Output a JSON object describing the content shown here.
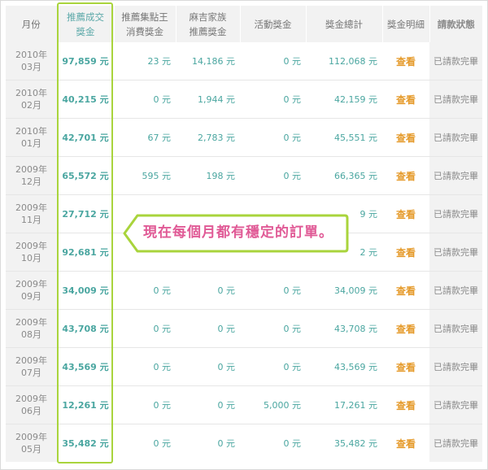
{
  "table": {
    "headers": {
      "month": "月份",
      "rec_line1": "推薦成交",
      "rec_line2": "獎金",
      "jxd_line1": "推薦集點王",
      "jxd_line2": "消費獎金",
      "family_line1": "麻吉家族",
      "family_line2": "推薦獎金",
      "event": "活動獎金",
      "total": "獎金總計",
      "detail": "獎金明細",
      "status": "請款狀態"
    },
    "rows": [
      {
        "year": "2010年",
        "month": "03月",
        "rec": "97,859 元",
        "jxd": "23 元",
        "family": "14,186 元",
        "event": "0 元",
        "total": "112,068 元",
        "view": "查看",
        "status": "已請款完畢"
      },
      {
        "year": "2010年",
        "month": "02月",
        "rec": "40,215 元",
        "jxd": "0 元",
        "family": "1,944 元",
        "event": "0 元",
        "total": "42,159 元",
        "view": "查看",
        "status": "已請款完畢"
      },
      {
        "year": "2010年",
        "month": "01月",
        "rec": "42,701 元",
        "jxd": "67 元",
        "family": "2,783 元",
        "event": "0 元",
        "total": "45,551 元",
        "view": "查看",
        "status": "已請款完畢"
      },
      {
        "year": "2009年",
        "month": "12月",
        "rec": "65,572 元",
        "jxd": "595 元",
        "family": "198 元",
        "event": "0 元",
        "total": "66,365 元",
        "view": "查看",
        "status": "已請款完畢"
      },
      {
        "year": "2009年",
        "month": "11月",
        "rec": "27,712 元",
        "jxd": "",
        "family": "",
        "event": "",
        "total": "9 元",
        "view": "查看",
        "status": "已請款完畢"
      },
      {
        "year": "2009年",
        "month": "10月",
        "rec": "92,681 元",
        "jxd": "",
        "family": "",
        "event": "",
        "total": "2 元",
        "view": "查看",
        "status": "已請款完畢"
      },
      {
        "year": "2009年",
        "month": "09月",
        "rec": "34,009 元",
        "jxd": "0 元",
        "family": "0 元",
        "event": "0 元",
        "total": "34,009 元",
        "view": "查看",
        "status": "已請款完畢"
      },
      {
        "year": "2009年",
        "month": "08月",
        "rec": "43,708 元",
        "jxd": "0 元",
        "family": "0 元",
        "event": "0 元",
        "total": "43,708 元",
        "view": "查看",
        "status": "已請款完畢"
      },
      {
        "year": "2009年",
        "month": "07月",
        "rec": "43,569 元",
        "jxd": "0 元",
        "family": "0 元",
        "event": "0 元",
        "total": "43,569 元",
        "view": "查看",
        "status": "已請款完畢"
      },
      {
        "year": "2009年",
        "month": "06月",
        "rec": "12,261 元",
        "jxd": "0 元",
        "family": "0 元",
        "event": "5,000 元",
        "total": "17,261 元",
        "view": "查看",
        "status": "已請款完畢"
      },
      {
        "year": "2009年",
        "month": "05月",
        "rec": "35,482 元",
        "jxd": "0 元",
        "family": "0 元",
        "event": "0 元",
        "total": "35,482 元",
        "view": "查看",
        "status": "已請款完畢"
      }
    ]
  },
  "annotation": {
    "callout_text": "現在每個月都有穩定的訂單。",
    "accent_color": "#a9d43c",
    "text_color": "#e05a96"
  }
}
